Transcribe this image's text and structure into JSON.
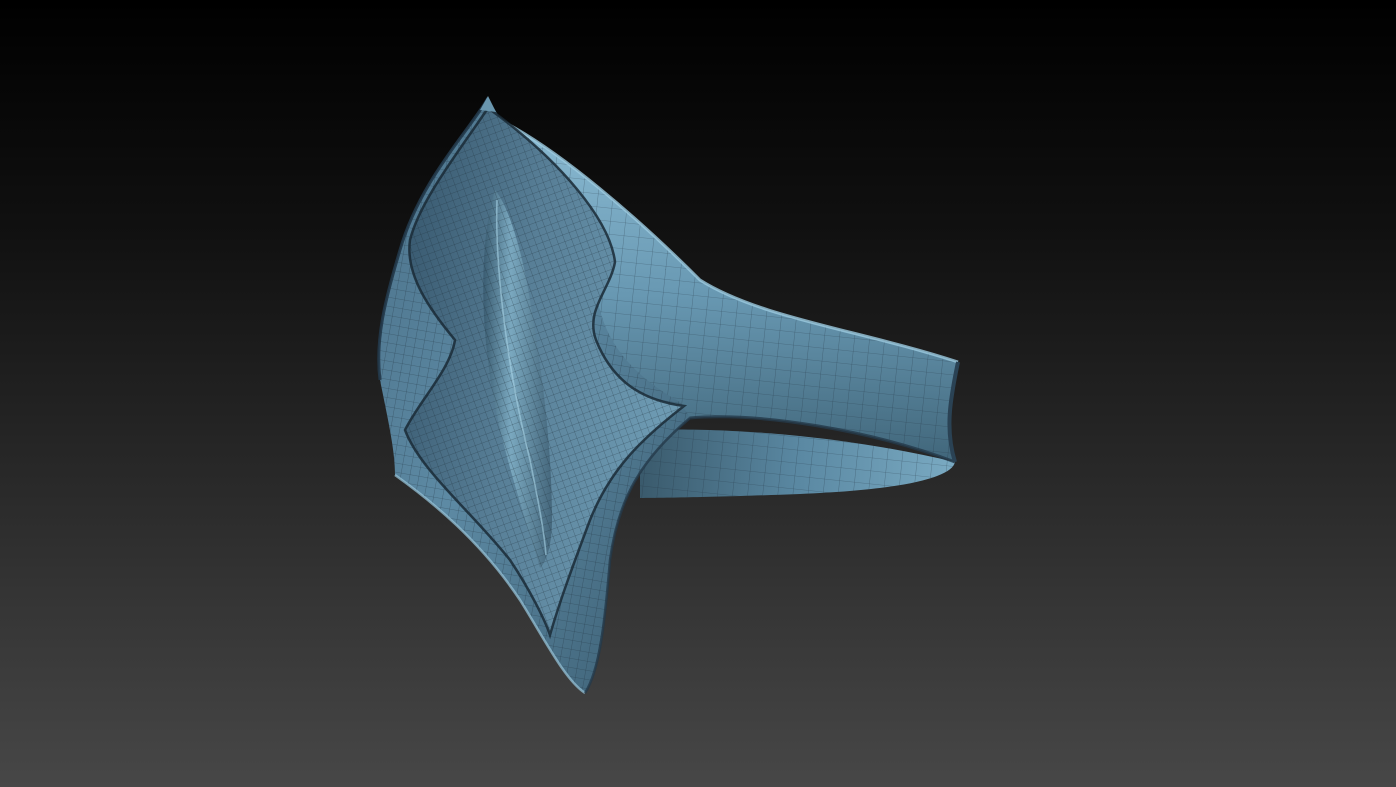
{
  "viewport": {
    "background_top": "#000000",
    "background_bottom": "#474747"
  },
  "model": {
    "surface_color": "#5f8ea8",
    "surface_light": "#7fb0c8",
    "surface_dark": "#2e4a5c",
    "wire_color": "#1c2c38"
  }
}
